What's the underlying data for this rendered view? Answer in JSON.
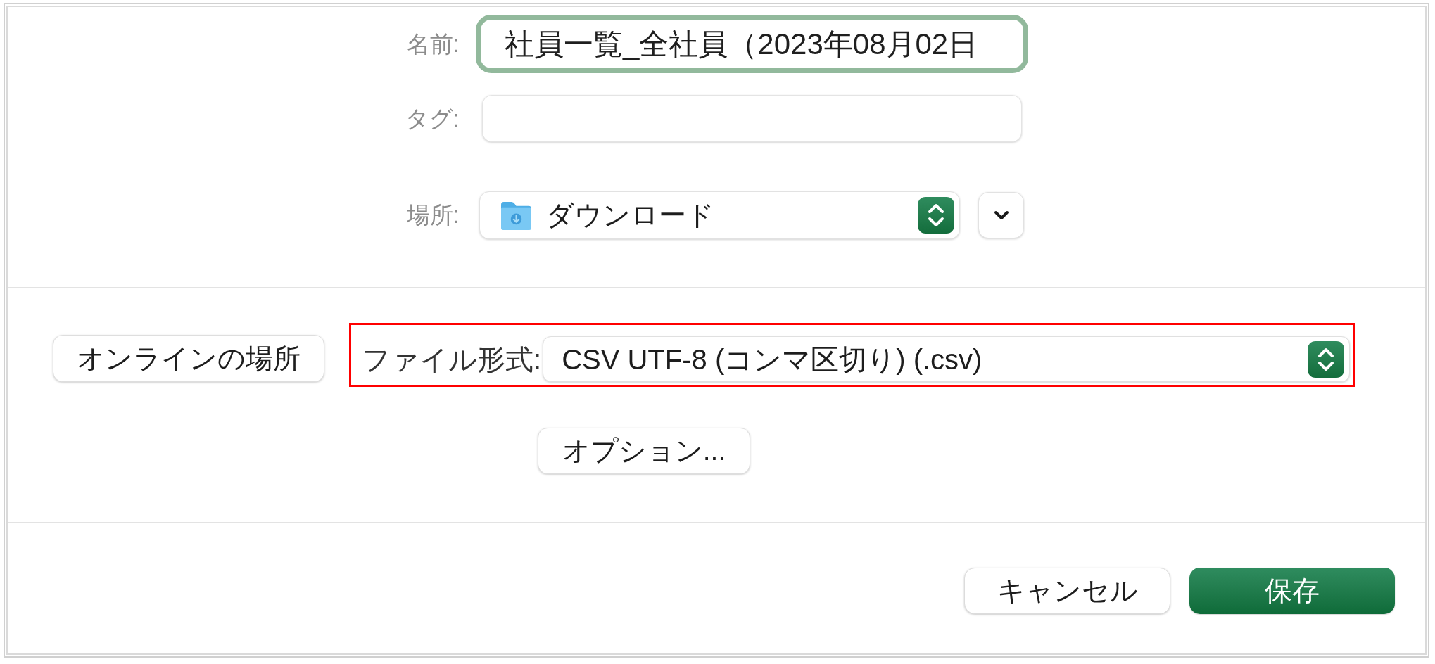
{
  "name_field": {
    "label": "名前:",
    "value": "社員一覧_全社員（2023年08月02日",
    "focused": true
  },
  "tags_field": {
    "label": "タグ:"
  },
  "location": {
    "label": "場所:",
    "value": "ダウンロード",
    "expanded": false
  },
  "online_locations_button": {
    "label": "オンラインの場所"
  },
  "file_format": {
    "label": "ファイル形式:",
    "value": "CSV UTF-8 (コンマ区切り) (.csv)",
    "highlighted": true
  },
  "options_button": {
    "label": "オプション..."
  },
  "buttons": [
    {
      "label": "キャンセル",
      "kind": "secondary"
    },
    {
      "label": "保存",
      "kind": "primary"
    }
  ]
}
